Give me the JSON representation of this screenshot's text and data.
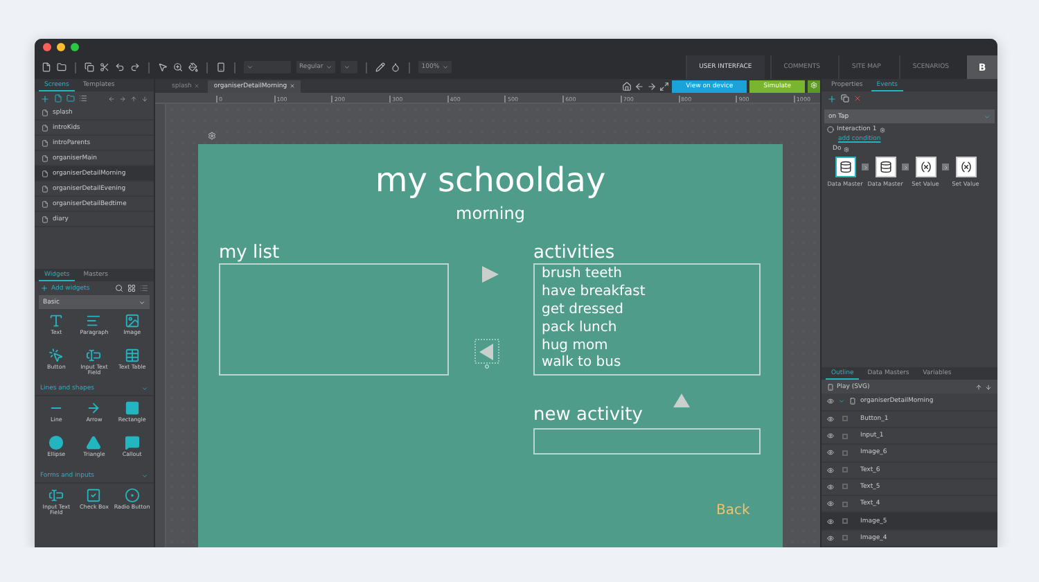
{
  "toolbar": {
    "font_style": "Regular",
    "zoom": "100%"
  },
  "mode_tabs": [
    {
      "label": "USER INTERFACE",
      "selected": true
    },
    {
      "label": "COMMENTS",
      "selected": false
    },
    {
      "label": "SITE MAP",
      "selected": false
    },
    {
      "label": "SCENARIOS",
      "selected": false
    }
  ],
  "account": "B",
  "left_panel": {
    "tabs": [
      {
        "label": "Screens",
        "selected": true
      },
      {
        "label": "Templates",
        "selected": false
      }
    ],
    "screens": [
      {
        "label": "splash",
        "selected": false
      },
      {
        "label": "introKids",
        "selected": false
      },
      {
        "label": "introParents",
        "selected": false
      },
      {
        "label": "organiserMain",
        "selected": false
      },
      {
        "label": "organiserDetailMorning",
        "selected": true
      },
      {
        "label": "organiserDetailEvening",
        "selected": false
      },
      {
        "label": "organiserDetailBedtime",
        "selected": false
      },
      {
        "label": "diary",
        "selected": false
      }
    ],
    "widget_tabs": [
      {
        "label": "Widgets",
        "selected": true
      },
      {
        "label": "Masters",
        "selected": false
      }
    ],
    "add_widgets": "Add widgets",
    "sections": [
      {
        "title": "Basic",
        "kind": "select",
        "widgets": [
          {
            "label": "Text",
            "kind": "text"
          },
          {
            "label": "Paragraph",
            "kind": "paragraph"
          },
          {
            "label": "Image",
            "kind": "image"
          },
          {
            "label": "Button",
            "kind": "button"
          },
          {
            "label": "Input Text Field",
            "kind": "input"
          },
          {
            "label": "Text Table",
            "kind": "table"
          }
        ]
      },
      {
        "title": "Lines and shapes",
        "kind": "heading",
        "widgets": [
          {
            "label": "Line",
            "kind": "line"
          },
          {
            "label": "Arrow",
            "kind": "arrow"
          },
          {
            "label": "Rectangle",
            "kind": "rectangle"
          },
          {
            "label": "Ellipse",
            "kind": "ellipse"
          },
          {
            "label": "Triangle",
            "kind": "triangle"
          },
          {
            "label": "Callout",
            "kind": "callout"
          }
        ]
      },
      {
        "title": "Forms and inputs",
        "kind": "heading",
        "widgets": [
          {
            "label": "Input Text Field",
            "kind": "input"
          },
          {
            "label": "Check Box",
            "kind": "checkbox"
          },
          {
            "label": "Radio Button",
            "kind": "radio"
          }
        ]
      }
    ]
  },
  "editor": {
    "doc_tabs": [
      {
        "label": "splash",
        "selected": false
      },
      {
        "label": "organiserDetailMorning",
        "selected": true
      }
    ],
    "view_on_device": "View on device",
    "simulate": "Simulate",
    "ruler": [
      "0",
      "100",
      "200",
      "300",
      "400",
      "500",
      "600",
      "700",
      "800",
      "900",
      "1000"
    ]
  },
  "screen": {
    "title": "my schoolday",
    "subtitle": "morning",
    "list_label": "my list",
    "activities_label": "activities",
    "activities": [
      "brush teeth",
      "have breakfast",
      "get dressed",
      "pack lunch",
      "hug mom",
      "walk to bus"
    ],
    "new_activity_label": "new activity",
    "back": "Back"
  },
  "right_panel": {
    "tabs": [
      {
        "label": "Properties",
        "selected": false
      },
      {
        "label": "Events",
        "selected": true
      }
    ],
    "event": "on Tap",
    "interaction": "Interaction 1",
    "condition": "add condition",
    "do": "Do",
    "actions": [
      {
        "label": "Data Master",
        "kind": "data",
        "selected": true
      },
      {
        "label": "Data Master",
        "kind": "data",
        "selected": false
      },
      {
        "label": "Set Value",
        "kind": "variable",
        "selected": false
      },
      {
        "label": "Set Value",
        "kind": "variable",
        "selected": false
      }
    ],
    "outline_tabs": [
      {
        "label": "Outline",
        "selected": true
      },
      {
        "label": "Data Masters",
        "selected": false
      },
      {
        "label": "Variables",
        "selected": false
      }
    ],
    "device": "Play (SVG)",
    "tree": {
      "label": "organiserDetailMorning",
      "expanded": true,
      "children": [
        {
          "label": "Button_1",
          "selected": false
        },
        {
          "label": "Input_1",
          "selected": false
        },
        {
          "label": "Image_6",
          "selected": false
        },
        {
          "label": "Text_6",
          "selected": false
        },
        {
          "label": "Text_5",
          "selected": false
        },
        {
          "label": "Text_4",
          "selected": false
        },
        {
          "label": "Image_5",
          "selected": true
        },
        {
          "label": "Image_4",
          "selected": false
        }
      ]
    }
  }
}
